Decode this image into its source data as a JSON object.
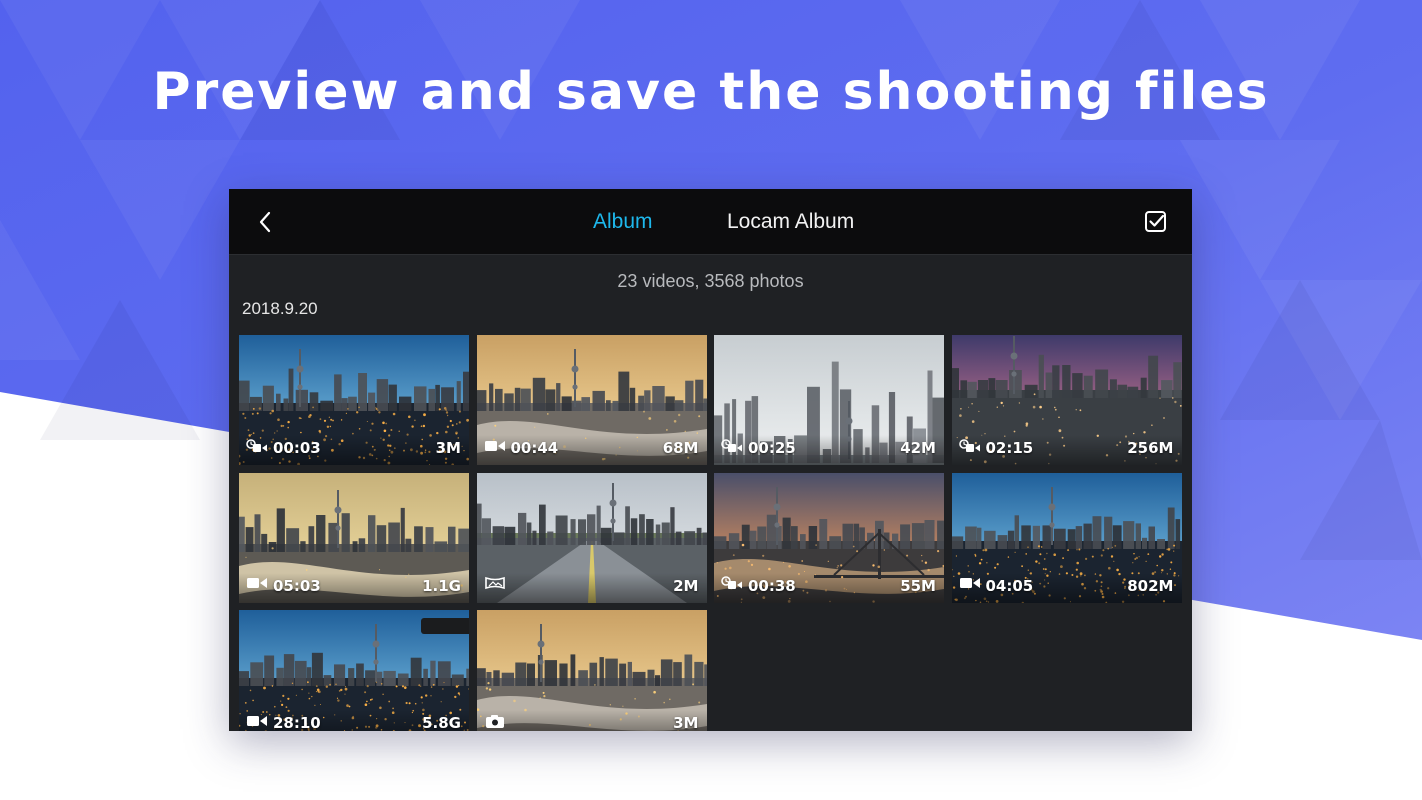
{
  "headline": "Preview and save the shooting files",
  "colors": {
    "background_blue": "#5c6bf0",
    "accent": "#1eb8ec",
    "panel": "#1f2124",
    "topbar": "#0c0c0d"
  },
  "header": {
    "back_icon": "chevron-left-icon",
    "tabs": [
      {
        "label": "Album",
        "active": true
      },
      {
        "label": "Locam Album",
        "active": false
      }
    ],
    "select_icon": "checkbox-checked-icon"
  },
  "album": {
    "summary": "23 videos, 3568 photos",
    "groups": [
      {
        "date": "2018.9.20",
        "items": [
          {
            "kind": "video-timelapse",
            "icon": "timelapse-video-icon",
            "duration": "00:03",
            "size": "3M",
            "scene": "blue-night"
          },
          {
            "kind": "video",
            "icon": "video-camera-icon",
            "duration": "00:44",
            "size": "68M",
            "scene": "golden-river"
          },
          {
            "kind": "video-timelapse",
            "icon": "timelapse-video-icon",
            "duration": "00:25",
            "size": "42M",
            "scene": "misty-towers"
          },
          {
            "kind": "video-timelapse",
            "icon": "timelapse-video-icon",
            "duration": "02:15",
            "size": "256M",
            "scene": "dusk-city"
          },
          {
            "kind": "video",
            "icon": "video-camera-icon",
            "duration": "05:03",
            "size": "1.1G",
            "scene": "hazy-river"
          },
          {
            "kind": "panorama",
            "icon": "panorama-icon",
            "duration": "",
            "size": "2M",
            "scene": "road"
          },
          {
            "kind": "video-timelapse",
            "icon": "timelapse-video-icon",
            "duration": "00:38",
            "size": "55M",
            "scene": "bridge-sunset"
          },
          {
            "kind": "video",
            "icon": "video-camera-icon",
            "duration": "04:05",
            "size": "802M",
            "scene": "blue-night"
          },
          {
            "kind": "video",
            "icon": "video-camera-icon",
            "duration": "28:10",
            "size": "5.8G",
            "scene": "blue-night"
          },
          {
            "kind": "photo",
            "icon": "camera-icon",
            "duration": "",
            "size": "3M",
            "scene": "golden-river"
          }
        ]
      }
    ]
  }
}
